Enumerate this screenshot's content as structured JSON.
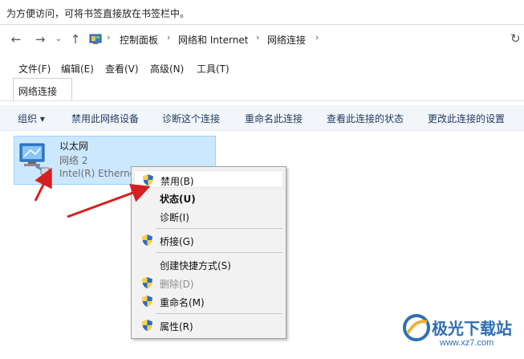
{
  "hint_bar": {
    "text": "为方便访问，可将书签直接放在书签栏中。"
  },
  "nav": {
    "back_icon": "arrow-left-icon",
    "forward_icon": "arrow-right-icon",
    "recent_icon": "chevron-down-icon",
    "up_icon": "arrow-up-icon",
    "breadcrumbs": [
      "控制面板",
      "网络和 Internet",
      "网络连接"
    ],
    "refresh_icon": "refresh-icon"
  },
  "menu": {
    "items": [
      "文件(F)",
      "编辑(E)",
      "查看(V)",
      "高级(N)",
      "工具(T)"
    ]
  },
  "tab": {
    "label": "网络连接"
  },
  "commands": {
    "organize": "组织 ▾",
    "items": [
      "禁用此网络设备",
      "诊断这个连接",
      "重命名此连接",
      "查看此连接的状态",
      "更改此连接的设置"
    ]
  },
  "network_item": {
    "name": "以太网",
    "network": "网络 2",
    "device": "Intel(R) Ethernet",
    "icon": "network-adapter-icon"
  },
  "context_menu": {
    "items": [
      {
        "label": "禁用(B)",
        "shield": true
      },
      {
        "label": "状态(U)",
        "bold": true
      },
      {
        "label": "诊断(I)"
      },
      {
        "label": "桥接(G)",
        "shield": true
      },
      {
        "label": "创建快捷方式(S)"
      },
      {
        "label": "删除(D)",
        "shield": true,
        "disabled": true
      },
      {
        "label": "重命名(M)",
        "shield": true
      },
      {
        "label": "属性(R)",
        "shield": true
      }
    ]
  },
  "watermark": {
    "title": "极光下载站",
    "url": "www.xz7.com"
  },
  "colors": {
    "selection_bg": "#cce8ff",
    "selection_border": "#99d1ff",
    "command_bar_bg": "#f2f5fa",
    "annotation_arrow": "#d42020"
  }
}
